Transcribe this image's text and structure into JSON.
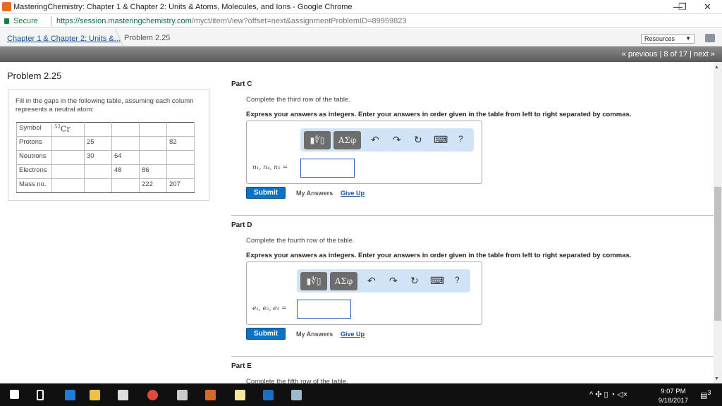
{
  "window": {
    "title": "MasteringChemistry: Chapter 1 & Chapter 2: Units & Atoms, Molecules, and Ions - Google Chrome",
    "minimize": "—",
    "restore": "❐",
    "close": "✕"
  },
  "address": {
    "secure": "Secure",
    "url_host": "https://session.masteringchemistry.com",
    "url_path": "/myct/itemView?offset=next&assignmentProblemID=89959823"
  },
  "breadcrumb": {
    "parent": "Chapter 1 & Chapter 2: Units &...",
    "current": "Problem 2.25"
  },
  "resources": {
    "label": "Resources",
    "arrow": "▼"
  },
  "pagination": {
    "previous": "« previous",
    "position": "8 of 17",
    "next": "next »",
    "sep": "|"
  },
  "problem": {
    "title": "Problem 2.25",
    "intro": "Fill in the gaps in the following table, assuming each column represents a neutral atom:",
    "table": [
      [
        "Symbol",
        "52|Cr",
        "",
        "",
        "",
        ""
      ],
      [
        "Protons",
        "",
        "25",
        "",
        "",
        "82"
      ],
      [
        "Neutrons",
        "",
        "30",
        "64",
        "",
        ""
      ],
      [
        "Electrons",
        "",
        "",
        "48",
        "86",
        ""
      ],
      [
        "Mass no.",
        "",
        "",
        "",
        "222",
        "207"
      ]
    ]
  },
  "symbol": {
    "mass": "52",
    "element": "Cr"
  },
  "parts": [
    {
      "title": "Part C",
      "question": "Complete the third row of the table.",
      "instruction": "Express your answers as integers. Enter your answers in order given in the table from left to right separated by commas.",
      "label": "n₁, n₄, n₅ =",
      "value": ""
    },
    {
      "title": "Part D",
      "question": "Complete the fourth row of the table.",
      "instruction": "Express your answers as integers. Enter your answers in order given in the table from left to right separated by commas.",
      "label": "e₁, e₂, e₅ =",
      "value": ""
    },
    {
      "title": "Part E",
      "question": "Complete the fifth row of the table."
    }
  ],
  "toolbar": {
    "templates": "▮∜▯",
    "symbols": "ΑΣφ",
    "undo": "↶",
    "redo": "↷",
    "reset": "↻",
    "keyboard": "⌨",
    "help": "?"
  },
  "actions": {
    "submit": "Submit",
    "my_answers": "My Answers",
    "give_up": "Give Up"
  },
  "taskbar": {
    "time": "9:07 PM",
    "date": "9/18/2017",
    "notifications": "3"
  }
}
